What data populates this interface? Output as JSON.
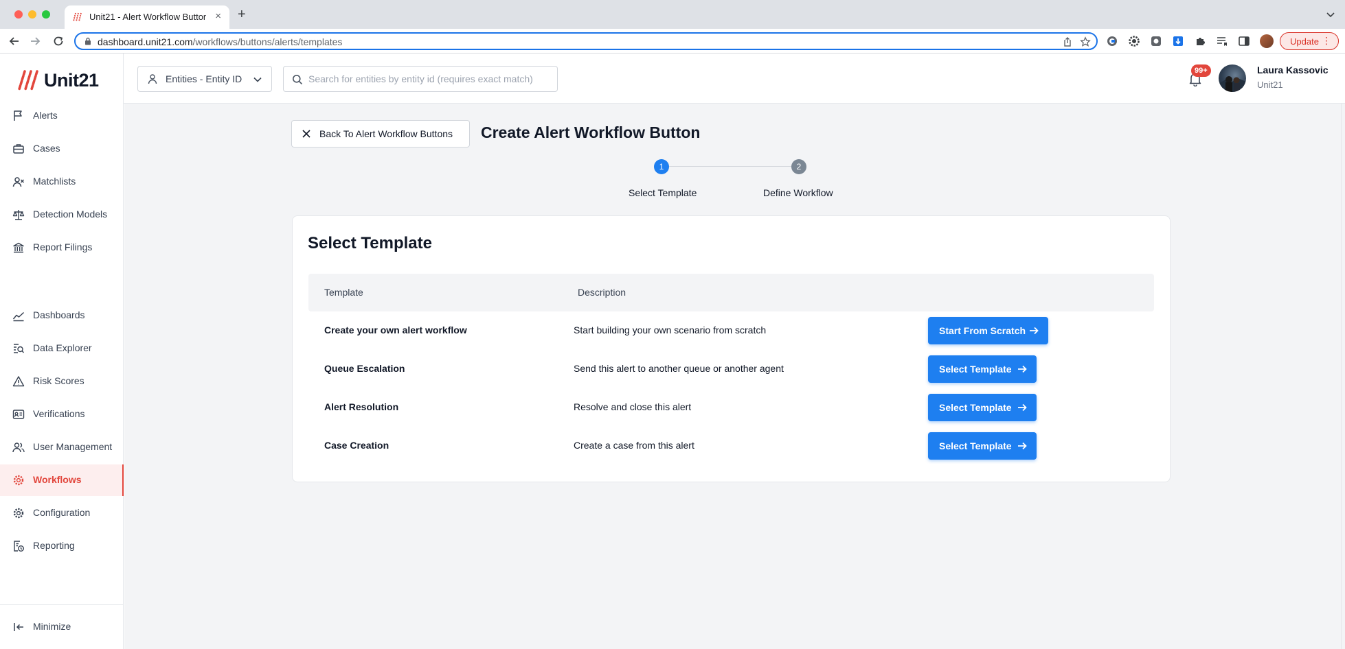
{
  "browser": {
    "tab_title": "Unit21 - Alert Workflow Button",
    "tab_close": "×",
    "new_tab": "+",
    "url_host": "dashboard.unit21.com",
    "url_path": "/workflows/buttons/alerts/templates",
    "update_label": "Update",
    "menu_glyph": "⋮"
  },
  "app": {
    "logo_text": "Unit21",
    "brand_color": "#e2463c",
    "accent_color": "#1e7ff0"
  },
  "sidebar": {
    "items": [
      {
        "label": "Alerts",
        "icon": "flag-icon"
      },
      {
        "label": "Cases",
        "icon": "briefcase-icon"
      },
      {
        "label": "Matchlists",
        "icon": "user-x-icon"
      },
      {
        "label": "Detection Models",
        "icon": "scale-icon"
      },
      {
        "label": "Report Filings",
        "icon": "bank-icon"
      },
      {
        "label": "Dashboards",
        "icon": "line-chart-icon"
      },
      {
        "label": "Data Explorer",
        "icon": "search-list-icon"
      },
      {
        "label": "Risk Scores",
        "icon": "warning-icon"
      },
      {
        "label": "Verifications",
        "icon": "id-card-icon"
      },
      {
        "label": "User Management",
        "icon": "users-icon"
      },
      {
        "label": "Workflows",
        "icon": "gear-icon",
        "active": true
      },
      {
        "label": "Configuration",
        "icon": "settings-icon"
      },
      {
        "label": "Reporting",
        "icon": "report-clock-icon"
      }
    ],
    "minimize_label": "Minimize"
  },
  "header": {
    "entity_select_value": "Entities - Entity ID",
    "search_placeholder": "Search for entities by entity id (requires exact match)",
    "notification_badge": "99+",
    "user_name": "Laura Kassovic",
    "user_org": "Unit21"
  },
  "page": {
    "back_label": "Back To Alert Workflow Buttons",
    "title": "Create Alert Workflow Button",
    "steps": [
      {
        "number": "1",
        "label": "Select Template",
        "state": "active"
      },
      {
        "number": "2",
        "label": "Define Workflow",
        "state": "inactive"
      }
    ]
  },
  "templates": {
    "title": "Select Template",
    "columns": [
      "Template",
      "Description"
    ],
    "rows": [
      {
        "name": "Create your own alert workflow",
        "description": "Start building your own scenario from scratch",
        "button": "Start From Scratch"
      },
      {
        "name": "Queue Escalation",
        "description": "Send this alert to another queue or another agent",
        "button": "Select Template"
      },
      {
        "name": "Alert Resolution",
        "description": "Resolve and close this alert",
        "button": "Select Template"
      },
      {
        "name": "Case Creation",
        "description": "Create a case from this alert",
        "button": "Select Template"
      }
    ]
  }
}
